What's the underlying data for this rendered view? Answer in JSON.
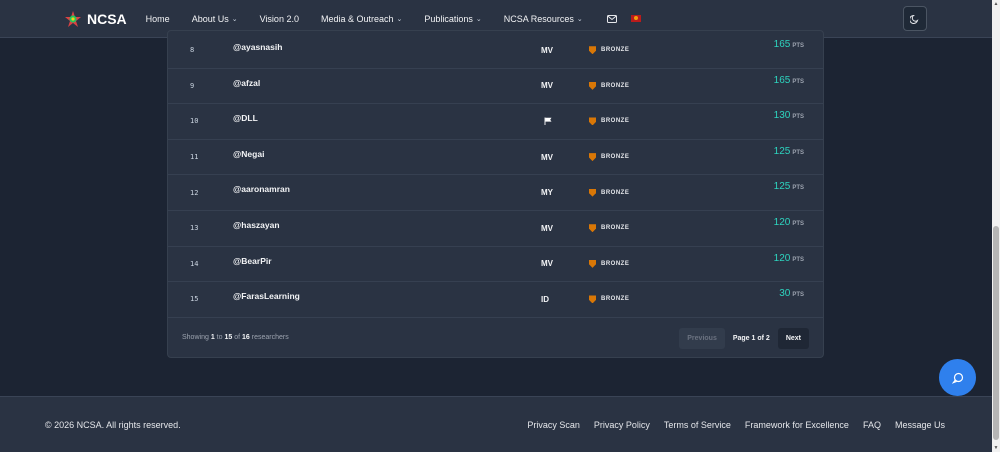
{
  "brand": {
    "name": "NCSA"
  },
  "nav": {
    "items": [
      {
        "label": "Home",
        "dropdown": false
      },
      {
        "label": "About Us",
        "dropdown": true
      },
      {
        "label": "Vision 2.0",
        "dropdown": false
      },
      {
        "label": "Media & Outreach",
        "dropdown": true
      },
      {
        "label": "Publications",
        "dropdown": true
      },
      {
        "label": "NCSA Resources",
        "dropdown": true
      }
    ],
    "chevron": "⌄"
  },
  "leaderboard": {
    "rows": [
      {
        "rank": "8",
        "handle": "@ayasnasih",
        "country": "MV",
        "badge": "BRONZE",
        "points": "165",
        "unit": "PTS"
      },
      {
        "rank": "9",
        "handle": "@afzal",
        "country": "MV",
        "badge": "BRONZE",
        "points": "165",
        "unit": "PTS"
      },
      {
        "rank": "10",
        "handle": "@DLL",
        "country": "",
        "badge": "BRONZE",
        "points": "130",
        "unit": "PTS"
      },
      {
        "rank": "11",
        "handle": "@Negai",
        "country": "MV",
        "badge": "BRONZE",
        "points": "125",
        "unit": "PTS"
      },
      {
        "rank": "12",
        "handle": "@aaronamran",
        "country": "MY",
        "badge": "BRONZE",
        "points": "125",
        "unit": "PTS"
      },
      {
        "rank": "13",
        "handle": "@haszayan",
        "country": "MV",
        "badge": "BRONZE",
        "points": "120",
        "unit": "PTS"
      },
      {
        "rank": "14",
        "handle": "@BearPir",
        "country": "MV",
        "badge": "BRONZE",
        "points": "120",
        "unit": "PTS"
      },
      {
        "rank": "15",
        "handle": "@FarasLearning",
        "country": "ID",
        "badge": "BRONZE",
        "points": "30",
        "unit": "PTS"
      }
    ],
    "footer": {
      "showing_prefix": "Showing",
      "from": "1",
      "to_word": "to",
      "to": "15",
      "of_word": "of",
      "total": "16",
      "suffix": "researchers",
      "previous": "Previous",
      "page_label": "Page 1 of 2",
      "next": "Next"
    }
  },
  "footer": {
    "copyright": "© 2026 NCSA. All rights reserved.",
    "links": [
      "Privacy Scan",
      "Privacy Policy",
      "Terms of Service",
      "Framework for Excellence",
      "FAQ",
      "Message Us"
    ]
  },
  "colors": {
    "accent": "#2dd4bf",
    "badge": "#d97706",
    "chat": "#2f80ed",
    "background": "#1c2433"
  },
  "icons": {
    "mail": "mail-icon",
    "flag": "flag-icon",
    "theme": "moon-icon",
    "chat": "chat-icon"
  }
}
